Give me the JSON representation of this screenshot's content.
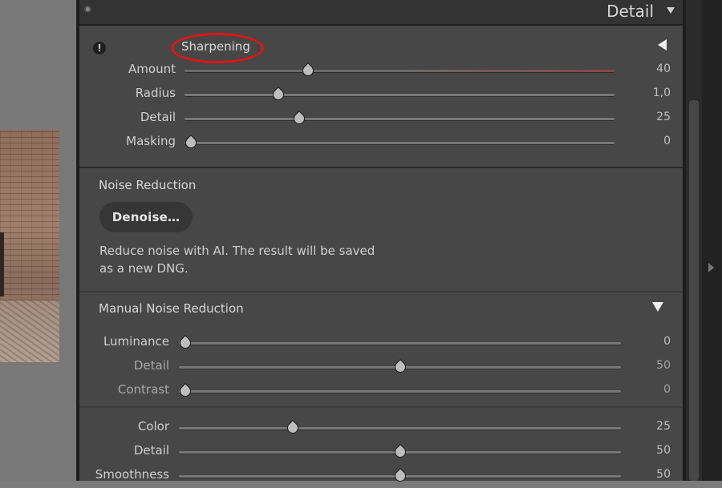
{
  "panel": {
    "title": "Detail"
  },
  "sharpening": {
    "title": "Sharpening",
    "sliders": [
      {
        "label": "Amount",
        "value": "40",
        "fraction": 0.28
      },
      {
        "label": "Radius",
        "value": "1,0",
        "fraction": 0.21
      },
      {
        "label": "Detail",
        "value": "25",
        "fraction": 0.26
      },
      {
        "label": "Masking",
        "value": "0",
        "fraction": 0.0
      }
    ]
  },
  "noise_reduction": {
    "title": "Noise Reduction",
    "denoise_label": "Denoise…",
    "description_line1": "Reduce noise with AI. The result will be saved",
    "description_line2": "as a new DNG."
  },
  "manual_noise_reduction": {
    "title": "Manual Noise Reduction",
    "sliders": [
      {
        "label": "Luminance",
        "value": "0",
        "fraction": 0.0
      },
      {
        "label": "Detail",
        "value": "50",
        "fraction": 0.5
      },
      {
        "label": "Contrast",
        "value": "0",
        "fraction": 0.0
      }
    ],
    "color_sliders": [
      {
        "label": "Color",
        "value": "25",
        "fraction": 0.25
      },
      {
        "label": "Detail",
        "value": "50",
        "fraction": 0.5
      },
      {
        "label": "Smoothness",
        "value": "50",
        "fraction": 0.5
      }
    ]
  },
  "colors": {
    "highlight": "#e01515",
    "panel_bg": "#474747"
  }
}
